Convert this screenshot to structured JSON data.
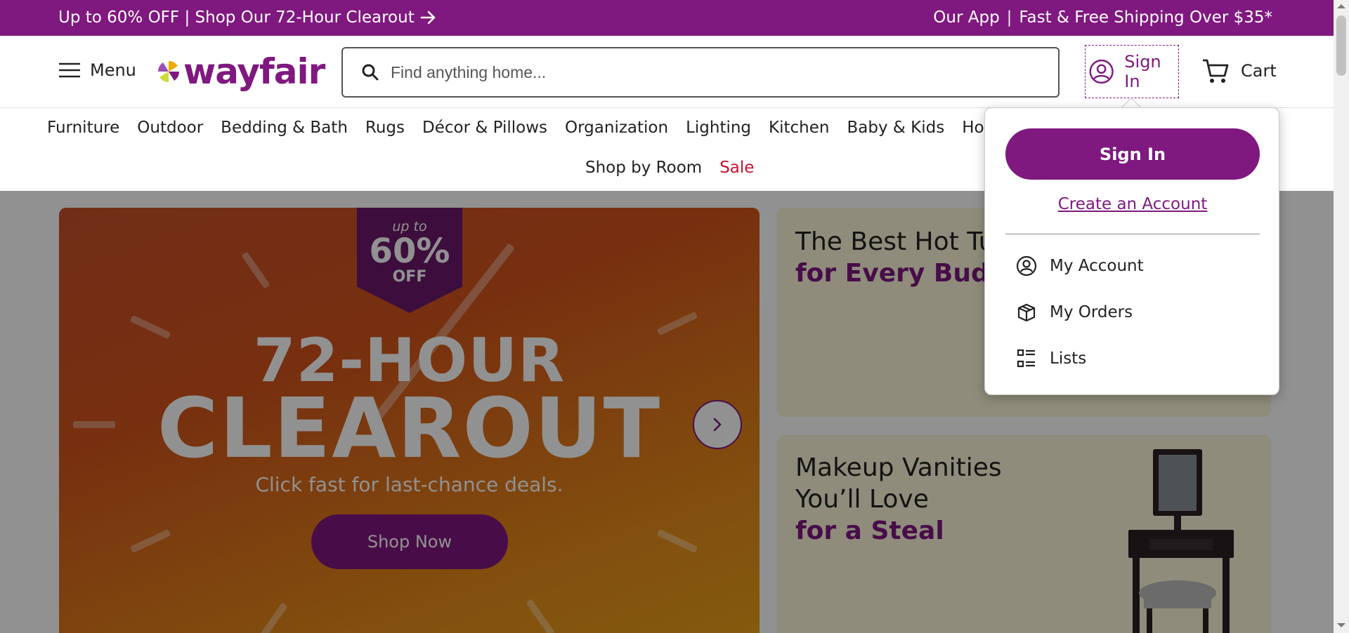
{
  "promo": {
    "left_text": "Up to 60% OFF | Shop Our 72-Hour Clearout",
    "app_link": "Our App",
    "separator": "|",
    "shipping": "Fast & Free Shipping Over $35*"
  },
  "header": {
    "menu_label": "Menu",
    "logo_text": "wayfair",
    "search_placeholder": "Find anything home...",
    "signin_label": "Sign In",
    "cart_label": "Cart"
  },
  "nav": {
    "row1": [
      "Furniture",
      "Outdoor",
      "Bedding & Bath",
      "Rugs",
      "Décor & Pillows",
      "Organization",
      "Lighting",
      "Kitchen",
      "Baby & Kids",
      "Home Im"
    ],
    "row2": [
      "Shop by Room"
    ],
    "sale_label": "Sale"
  },
  "hero": {
    "tag_upto": "up to",
    "tag_pct": "60%",
    "tag_off": "OFF",
    "headline1": "72-HOUR",
    "headline2": "CLEAROUT",
    "subtitle": "Click fast for last-chance deals.",
    "button_label": "Shop Now"
  },
  "cards": {
    "card1_line1": "The Best Hot Tu",
    "card1_line2": "for Every Budge",
    "card2_line1": "Makeup Vanities",
    "card2_line2": "You’ll Love",
    "card2_line3": "for a Steal"
  },
  "dropdown": {
    "signin_button": "Sign In",
    "create_account": "Create an Account",
    "items": [
      "My Account",
      "My Orders",
      "Lists"
    ]
  },
  "colors": {
    "brand": "#7f187f",
    "sale": "#c8102e"
  }
}
